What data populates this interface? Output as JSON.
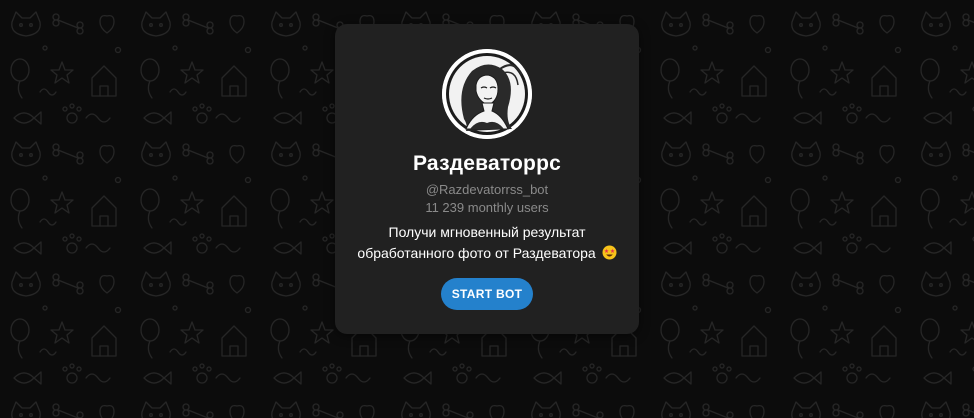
{
  "bot": {
    "name": "Раздеваторрс",
    "username": "@Razdevatorrss_bot",
    "monthly_users": "11 239 monthly users",
    "description": "Получи мгновенный результат обработанного фото от Раздеватора",
    "start_button_label": "START BOT"
  },
  "colors": {
    "background": "#0c0c0c",
    "card": "#212121",
    "button": "#2481cc",
    "secondary_text": "#8a8a8a"
  },
  "icons": {
    "avatar": "bot-avatar-portrait",
    "emoji": "star-struck-emoji",
    "background_pattern": "doodle-pattern"
  }
}
